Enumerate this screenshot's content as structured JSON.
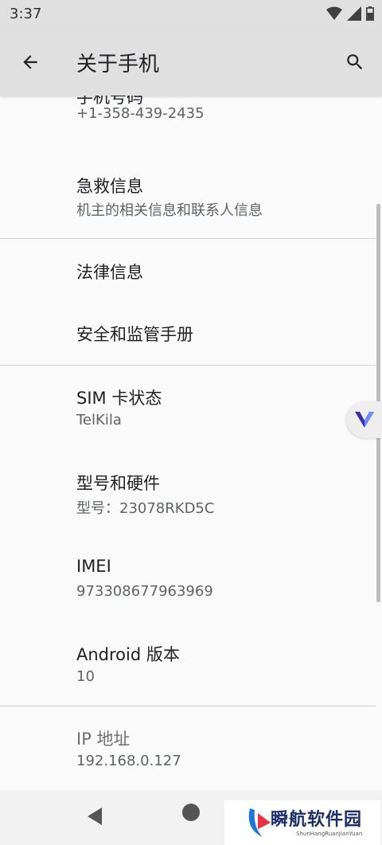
{
  "status": {
    "time": "3:37"
  },
  "appbar": {
    "title": "关于手机"
  },
  "rows": [
    {
      "title": "手机号码",
      "subtitle": "+1-358-439-2435"
    },
    {
      "title": "急救信息",
      "subtitle": "机主的相关信息和联系人信息"
    },
    {
      "title": "法律信息"
    },
    {
      "title": "安全和监管手册"
    },
    {
      "title": "SIM 卡状态",
      "subtitle": "TelKila"
    },
    {
      "title": "型号和硬件",
      "subtitle": "型号：23078RKD5C"
    },
    {
      "title": "IMEI",
      "subtitle": "973308677963969"
    },
    {
      "title": "Android 版本",
      "subtitle": "10"
    },
    {
      "title": "IP 地址",
      "subtitle": "192.168.0.127"
    }
  ],
  "watermark": {
    "text": "瞬航软件园",
    "sub": "ShunHangRuanJianYuan"
  }
}
